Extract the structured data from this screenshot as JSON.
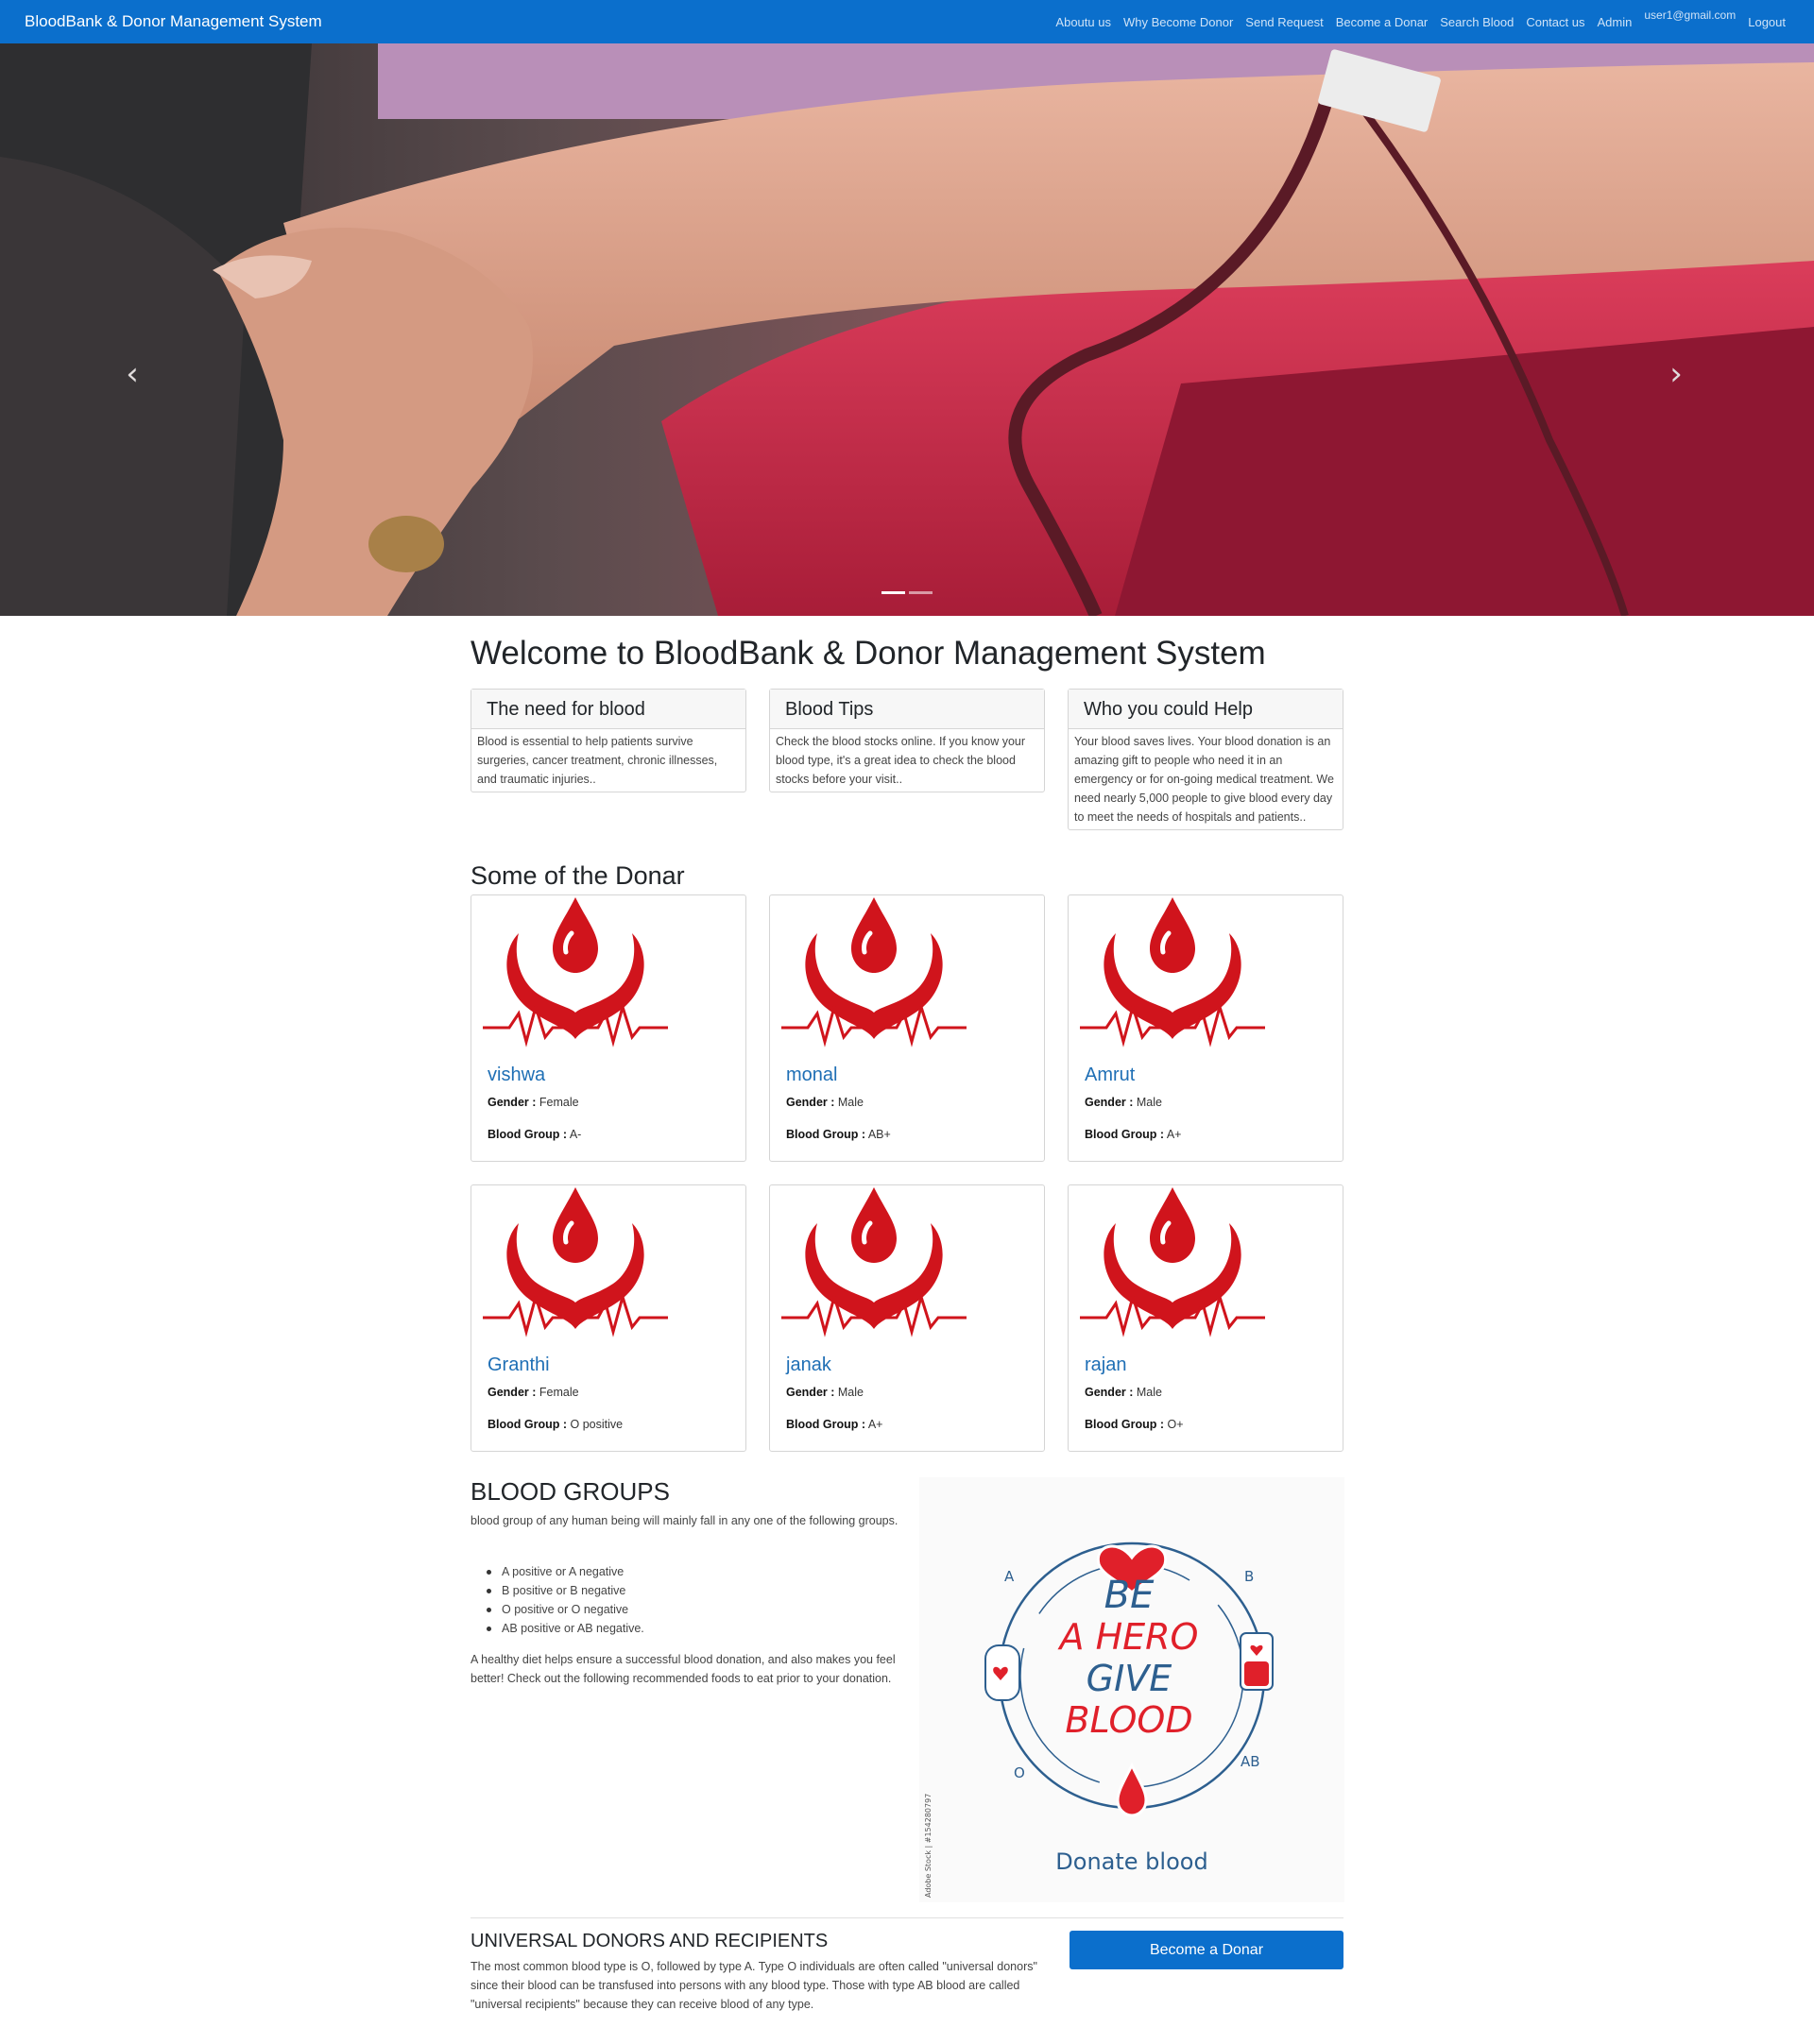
{
  "navbar": {
    "brand": "BloodBank & Donor Management System",
    "links": [
      "Aboutu us",
      "Why Become Donor",
      "Send Request",
      "Become a Donar",
      "Search Blood",
      "Contact us",
      "Admin"
    ],
    "user_email": "user1@gmail.com",
    "logout": "Logout"
  },
  "carousel": {
    "prev_icon": "‹",
    "next_icon": "›",
    "indicators": 2,
    "active_index": 0
  },
  "main": {
    "title": "Welcome to BloodBank & Donor Management System",
    "info_cards": [
      {
        "title": "The need for blood",
        "text": "Blood is essential to help patients survive surgeries, cancer treatment, chronic illnesses, and traumatic injuries.."
      },
      {
        "title": "Blood Tips",
        "text": "Check the blood stocks online. If you know your blood type, it's a great idea to check the blood stocks before your visit.."
      },
      {
        "title": "Who you could Help",
        "text": "Your blood saves lives. Your blood donation is an amazing gift to people who need it in an emergency or for on-going medical treatment. We need nearly 5,000 people to give blood every day to meet the needs of hospitals and patients.."
      }
    ],
    "donors_title": "Some of the Donar",
    "gender_label": "Gender :",
    "blood_group_label": "Blood Group :",
    "donors": [
      {
        "name": "vishwa",
        "gender": "Female",
        "blood_group": "A-"
      },
      {
        "name": "monal",
        "gender": "Male",
        "blood_group": "AB+"
      },
      {
        "name": "Amrut",
        "gender": "Male",
        "blood_group": "A+"
      },
      {
        "name": "Granthi",
        "gender": "Female",
        "blood_group": "O positive"
      },
      {
        "name": "janak",
        "gender": "Male",
        "blood_group": "A+"
      },
      {
        "name": "rajan",
        "gender": "Male",
        "blood_group": "O+"
      }
    ],
    "blood_groups": {
      "title": "BLOOD GROUPS",
      "intro": "blood group of any human being will mainly fall in any one of the following groups.",
      "items": [
        "A positive or A negative",
        "B positive or B negative",
        "O positive or O negative",
        "AB positive or AB negative."
      ],
      "diet_text": "A healthy diet helps ensure a successful blood donation, and also makes you feel better! Check out the following recommended foods to eat prior to your donation."
    },
    "poster": {
      "line1": "BE",
      "line2": "A HERO",
      "line3": "GIVE",
      "line4": "BLOOD",
      "caption": "Donate blood",
      "groups": [
        "A",
        "B",
        "O",
        "AB"
      ],
      "credit": "Adobe Stock | #154280797"
    },
    "universal": {
      "title": "UNIVERSAL DONORS AND RECIPIENTS",
      "text": "The most common blood type is O, followed by type A. Type O individuals are often called \"universal donors\" since their blood can be transfused into persons with any blood type. Those with type AB blood are called \"universal recipients\" because they can receive blood of any type.",
      "button": "Become a Donar"
    },
    "colors": {
      "navbar": "#0b6fcc",
      "donor_name": "#1f6fb5",
      "blood_red": "#d0141c",
      "poster_blue": "#2d5f8f"
    }
  }
}
